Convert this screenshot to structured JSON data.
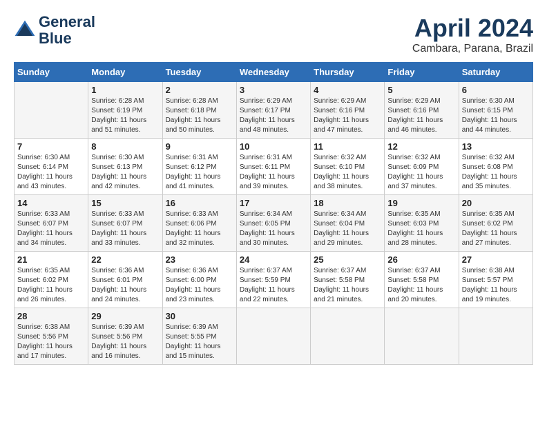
{
  "header": {
    "logo_line1": "General",
    "logo_line2": "Blue",
    "month": "April 2024",
    "location": "Cambara, Parana, Brazil"
  },
  "weekdays": [
    "Sunday",
    "Monday",
    "Tuesday",
    "Wednesday",
    "Thursday",
    "Friday",
    "Saturday"
  ],
  "weeks": [
    [
      {
        "day": "",
        "info": ""
      },
      {
        "day": "1",
        "info": "Sunrise: 6:28 AM\nSunset: 6:19 PM\nDaylight: 11 hours\nand 51 minutes."
      },
      {
        "day": "2",
        "info": "Sunrise: 6:28 AM\nSunset: 6:18 PM\nDaylight: 11 hours\nand 50 minutes."
      },
      {
        "day": "3",
        "info": "Sunrise: 6:29 AM\nSunset: 6:17 PM\nDaylight: 11 hours\nand 48 minutes."
      },
      {
        "day": "4",
        "info": "Sunrise: 6:29 AM\nSunset: 6:16 PM\nDaylight: 11 hours\nand 47 minutes."
      },
      {
        "day": "5",
        "info": "Sunrise: 6:29 AM\nSunset: 6:16 PM\nDaylight: 11 hours\nand 46 minutes."
      },
      {
        "day": "6",
        "info": "Sunrise: 6:30 AM\nSunset: 6:15 PM\nDaylight: 11 hours\nand 44 minutes."
      }
    ],
    [
      {
        "day": "7",
        "info": "Sunrise: 6:30 AM\nSunset: 6:14 PM\nDaylight: 11 hours\nand 43 minutes."
      },
      {
        "day": "8",
        "info": "Sunrise: 6:30 AM\nSunset: 6:13 PM\nDaylight: 11 hours\nand 42 minutes."
      },
      {
        "day": "9",
        "info": "Sunrise: 6:31 AM\nSunset: 6:12 PM\nDaylight: 11 hours\nand 41 minutes."
      },
      {
        "day": "10",
        "info": "Sunrise: 6:31 AM\nSunset: 6:11 PM\nDaylight: 11 hours\nand 39 minutes."
      },
      {
        "day": "11",
        "info": "Sunrise: 6:32 AM\nSunset: 6:10 PM\nDaylight: 11 hours\nand 38 minutes."
      },
      {
        "day": "12",
        "info": "Sunrise: 6:32 AM\nSunset: 6:09 PM\nDaylight: 11 hours\nand 37 minutes."
      },
      {
        "day": "13",
        "info": "Sunrise: 6:32 AM\nSunset: 6:08 PM\nDaylight: 11 hours\nand 35 minutes."
      }
    ],
    [
      {
        "day": "14",
        "info": "Sunrise: 6:33 AM\nSunset: 6:07 PM\nDaylight: 11 hours\nand 34 minutes."
      },
      {
        "day": "15",
        "info": "Sunrise: 6:33 AM\nSunset: 6:07 PM\nDaylight: 11 hours\nand 33 minutes."
      },
      {
        "day": "16",
        "info": "Sunrise: 6:33 AM\nSunset: 6:06 PM\nDaylight: 11 hours\nand 32 minutes."
      },
      {
        "day": "17",
        "info": "Sunrise: 6:34 AM\nSunset: 6:05 PM\nDaylight: 11 hours\nand 30 minutes."
      },
      {
        "day": "18",
        "info": "Sunrise: 6:34 AM\nSunset: 6:04 PM\nDaylight: 11 hours\nand 29 minutes."
      },
      {
        "day": "19",
        "info": "Sunrise: 6:35 AM\nSunset: 6:03 PM\nDaylight: 11 hours\nand 28 minutes."
      },
      {
        "day": "20",
        "info": "Sunrise: 6:35 AM\nSunset: 6:02 PM\nDaylight: 11 hours\nand 27 minutes."
      }
    ],
    [
      {
        "day": "21",
        "info": "Sunrise: 6:35 AM\nSunset: 6:02 PM\nDaylight: 11 hours\nand 26 minutes."
      },
      {
        "day": "22",
        "info": "Sunrise: 6:36 AM\nSunset: 6:01 PM\nDaylight: 11 hours\nand 24 minutes."
      },
      {
        "day": "23",
        "info": "Sunrise: 6:36 AM\nSunset: 6:00 PM\nDaylight: 11 hours\nand 23 minutes."
      },
      {
        "day": "24",
        "info": "Sunrise: 6:37 AM\nSunset: 5:59 PM\nDaylight: 11 hours\nand 22 minutes."
      },
      {
        "day": "25",
        "info": "Sunrise: 6:37 AM\nSunset: 5:58 PM\nDaylight: 11 hours\nand 21 minutes."
      },
      {
        "day": "26",
        "info": "Sunrise: 6:37 AM\nSunset: 5:58 PM\nDaylight: 11 hours\nand 20 minutes."
      },
      {
        "day": "27",
        "info": "Sunrise: 6:38 AM\nSunset: 5:57 PM\nDaylight: 11 hours\nand 19 minutes."
      }
    ],
    [
      {
        "day": "28",
        "info": "Sunrise: 6:38 AM\nSunset: 5:56 PM\nDaylight: 11 hours\nand 17 minutes."
      },
      {
        "day": "29",
        "info": "Sunrise: 6:39 AM\nSunset: 5:56 PM\nDaylight: 11 hours\nand 16 minutes."
      },
      {
        "day": "30",
        "info": "Sunrise: 6:39 AM\nSunset: 5:55 PM\nDaylight: 11 hours\nand 15 minutes."
      },
      {
        "day": "",
        "info": ""
      },
      {
        "day": "",
        "info": ""
      },
      {
        "day": "",
        "info": ""
      },
      {
        "day": "",
        "info": ""
      }
    ]
  ]
}
